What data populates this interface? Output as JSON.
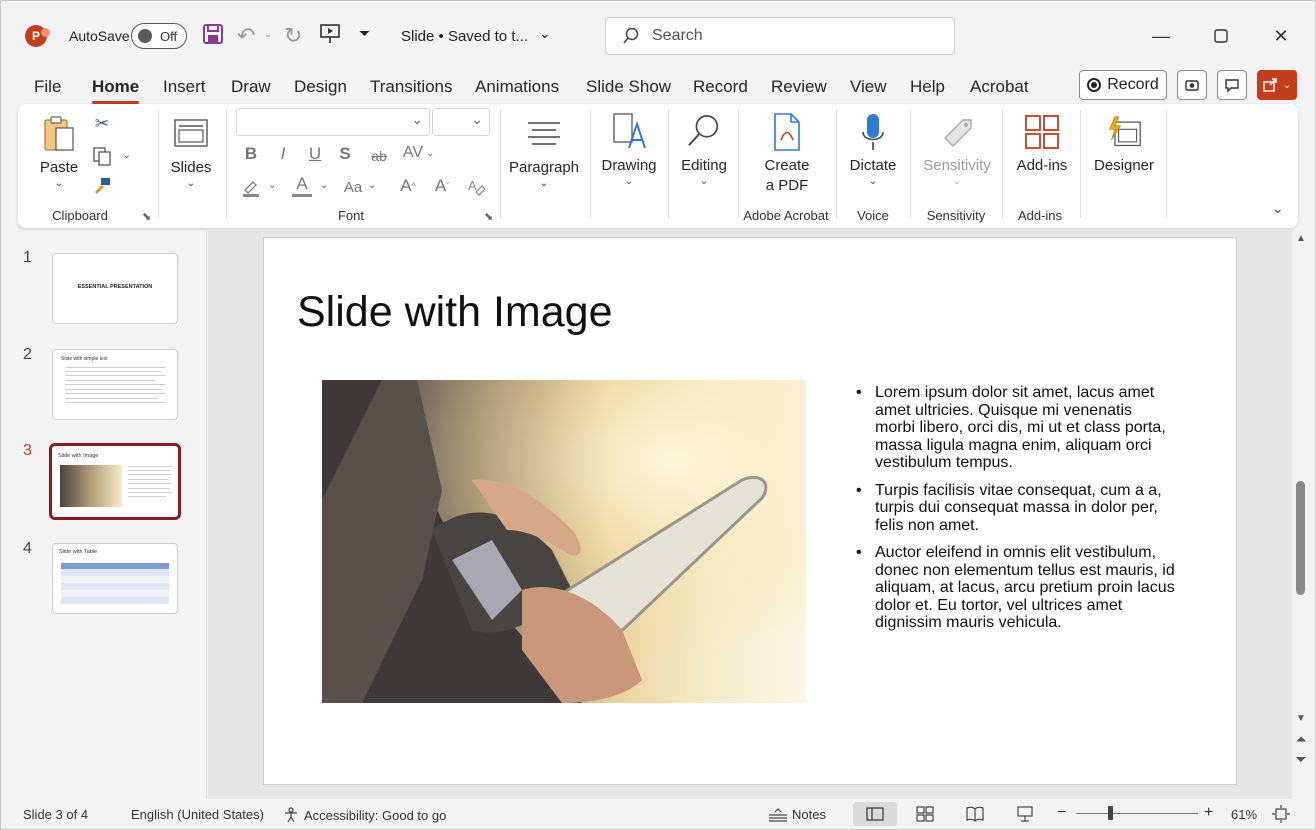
{
  "titlebar": {
    "autosave_label": "AutoSave",
    "autosave_state": "Off",
    "document_title": "Slide • Saved to t...",
    "search_placeholder": "Search"
  },
  "menu": {
    "tabs": [
      "File",
      "Home",
      "Insert",
      "Draw",
      "Design",
      "Transitions",
      "Animations",
      "Slide Show",
      "Record",
      "Review",
      "View",
      "Help",
      "Acrobat"
    ],
    "active_tab": "Home",
    "record_button": "Record"
  },
  "ribbon": {
    "clipboard": {
      "paste": "Paste",
      "label": "Clipboard"
    },
    "slides": {
      "label": "Slides"
    },
    "font": {
      "label": "Font",
      "bold": "B",
      "italic": "I",
      "underline": "U",
      "strike": "S",
      "abc": "ab",
      "av": "AV",
      "aa": "Aa",
      "grow": "A^",
      "shrink": "A˅"
    },
    "paragraph": {
      "label": "Paragraph"
    },
    "drawing": {
      "label": "Drawing"
    },
    "editing": {
      "label": "Editing"
    },
    "acrobat": {
      "create_line1": "Create",
      "create_line2": "a PDF",
      "label": "Adobe Acrobat"
    },
    "voice": {
      "dictate": "Dictate",
      "label": "Voice"
    },
    "sensitivity": {
      "button": "Sensitivity",
      "label": "Sensitivity"
    },
    "addins": {
      "button": "Add-ins",
      "label": "Add-ins"
    },
    "designer": {
      "button": "Designer"
    }
  },
  "thumbnails": [
    {
      "number": "1",
      "title": "ESSENTIAL PRESENTATION"
    },
    {
      "number": "2",
      "title": "Slide with simple text"
    },
    {
      "number": "3",
      "title": "Slide with Image"
    },
    {
      "number": "4",
      "title": "Slide with Table"
    }
  ],
  "selected_slide": 3,
  "slide": {
    "title": "Slide with Image",
    "bullets": [
      "Lorem ipsum dolor sit amet, lacus amet amet ultricies. Quisque mi venenatis morbi libero, orci dis, mi ut et class porta, massa ligula magna enim, aliquam orci vestibulum tempus.",
      "Turpis facilisis vitae consequat, cum a a, turpis dui consequat massa in dolor per, felis non amet.",
      "Auctor eleifend in omnis elit vestibulum, donec non elementum tellus est mauris, id aliquam, at lacus, arcu pretium proin lacus dolor et. Eu tortor, vel ultrices amet dignissim mauris vehicula."
    ]
  },
  "statusbar": {
    "slide_counter": "Slide 3 of 4",
    "language": "English (United States)",
    "accessibility": "Accessibility: Good to go",
    "notes": "Notes",
    "zoom": "61%",
    "zoom_minus": "−",
    "zoom_plus": "+"
  },
  "colors": {
    "accent": "#c43e1c",
    "selected_thumb_border": "#8b1a22"
  }
}
